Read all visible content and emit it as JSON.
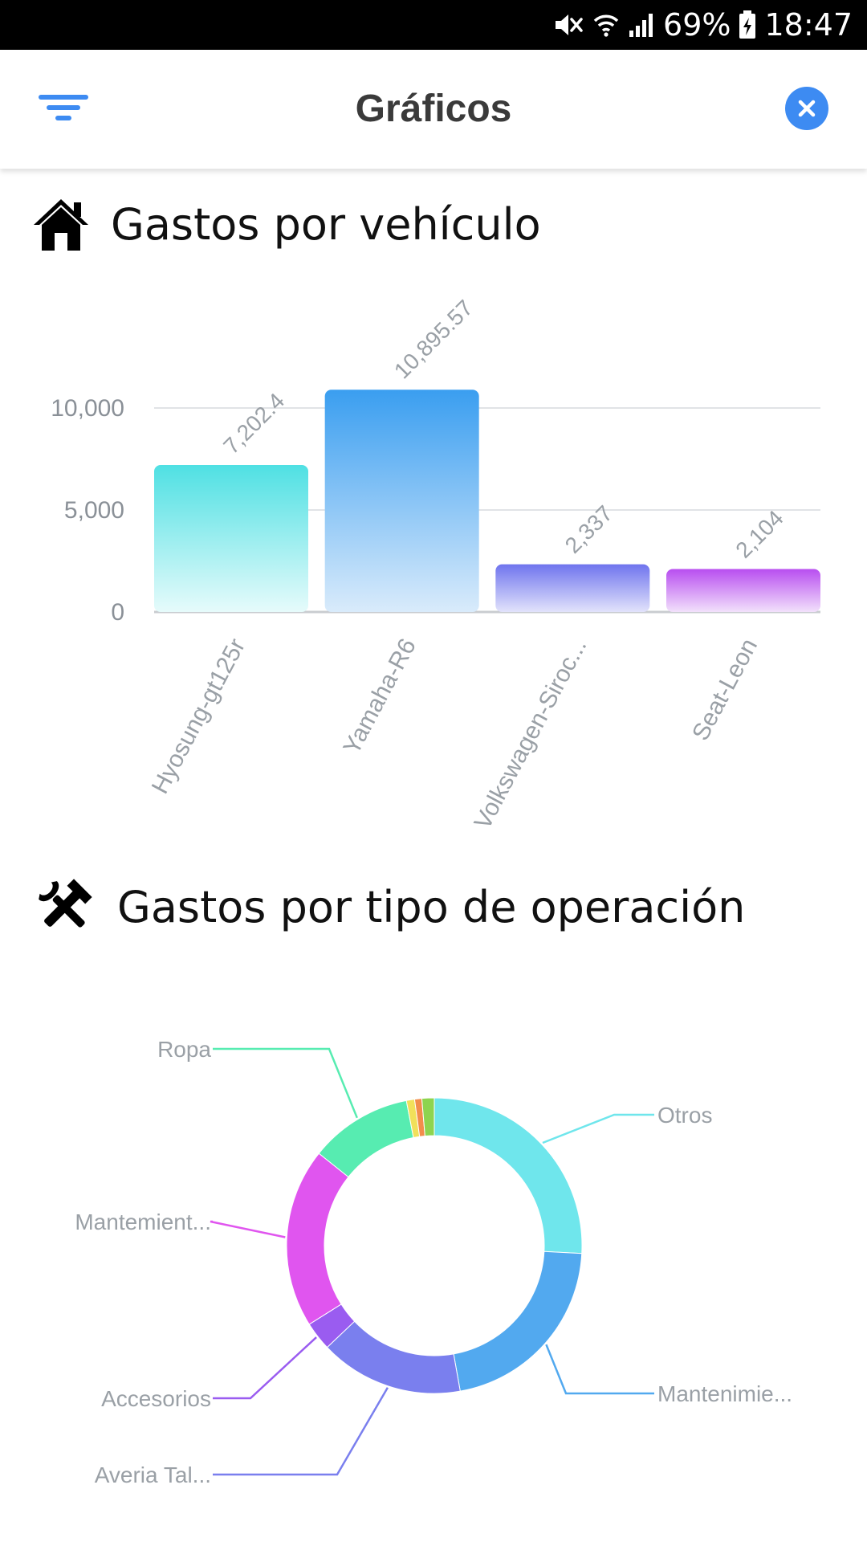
{
  "status_bar": {
    "battery": "69%",
    "time": "18:47"
  },
  "header": {
    "title": "Gráficos"
  },
  "section_vehicles": {
    "title": "Gastos por vehículo"
  },
  "section_operations": {
    "title": "Gastos por tipo de operación"
  },
  "chart_data": [
    {
      "type": "bar",
      "categories": [
        "Hyosung-gt125r",
        "Yamaha-R6",
        "Volkswagen-Siroc...",
        "Seat-Leon"
      ],
      "values": [
        7202.4,
        10895.57,
        2337,
        2104
      ],
      "value_labels": [
        "7,202.4",
        "10,895.57",
        "2,337",
        "2,104"
      ],
      "y_ticks": [
        "0",
        "5,000",
        "10,000"
      ],
      "ylim": [
        0,
        10000
      ],
      "grid": true,
      "colors": [
        [
          "#4fe0e3",
          "#e6fbfb"
        ],
        [
          "#3a9ef0",
          "#d9ebfb"
        ],
        [
          "#6f74ee",
          "#e2e3fb"
        ],
        [
          "#b84ef0",
          "#f2e1fb"
        ]
      ]
    },
    {
      "type": "pie",
      "style": "donut",
      "labels": [
        "Otros",
        "Mantenimie...",
        "Averia Tal...",
        "Accesorios",
        "Mantemient...",
        "Ropa",
        "",
        "",
        ""
      ],
      "values": [
        23.0,
        19.0,
        14.0,
        2.8,
        17.5,
        10.0,
        0.8,
        0.7,
        1.2
      ],
      "colors": [
        "#6fe6ec",
        "#52a9ef",
        "#7a7fee",
        "#9a5cf0",
        "#e055ef",
        "#57ecb1",
        "#f1e05a",
        "#f28d4b",
        "#8ed44f"
      ]
    }
  ]
}
